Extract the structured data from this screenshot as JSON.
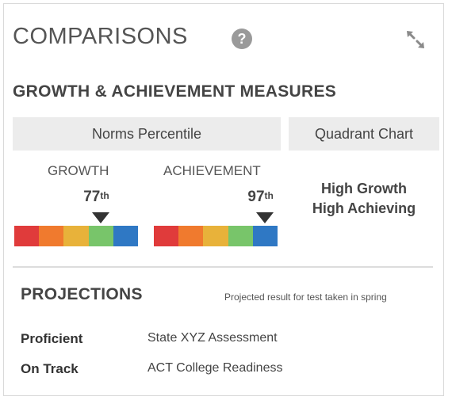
{
  "header": {
    "title": "COMPARISONS",
    "help_symbol": "?",
    "help_icon": "question-circle-icon",
    "expand_icon": "expand-arrows-icon"
  },
  "growth_achievement": {
    "title": "GROWTH & ACHIEVEMENT MEASURES",
    "tabs": [
      {
        "label": "Norms Percentile"
      },
      {
        "label": "Quadrant Chart"
      }
    ],
    "growth": {
      "label": "GROWTH",
      "percentile": "77",
      "suffix": "th",
      "value": 77
    },
    "achievement": {
      "label": "ACHIEVEMENT",
      "percentile": "97",
      "suffix": "th",
      "value": 97
    },
    "quadrant": {
      "line1": "High Growth",
      "line2": "High Achieving"
    },
    "scale_colors": [
      "#e03b3b",
      "#f07a2e",
      "#e8b23a",
      "#78c56a",
      "#2f78c4"
    ]
  },
  "projections": {
    "title": "PROJECTIONS",
    "note": "Projected result for test taken in spring",
    "rows": [
      {
        "status": "Proficient",
        "test": "State XYZ Assessment"
      },
      {
        "status": "On Track",
        "test": "ACT College Readiness"
      }
    ]
  }
}
